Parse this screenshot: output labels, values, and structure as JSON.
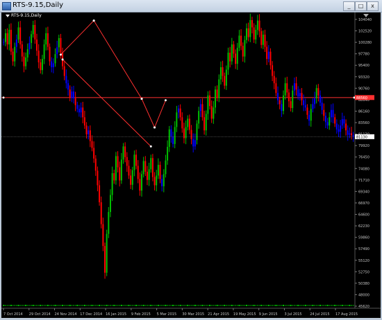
{
  "window": {
    "title": "RTS-9.15,Daily",
    "minimize_label": "_",
    "maximize_label": "□",
    "close_label": "x"
  },
  "chart_label": "RTS-9.15,Daily",
  "colors": {
    "background": "#000000",
    "bull": "#00c000",
    "bear": "#ff0000",
    "neutral": "#0000ff",
    "grid": "#2a2a2a",
    "axis_text": "#c8c8c8",
    "trend": "#ff3030"
  },
  "chart_data": {
    "type": "candlestick",
    "title": "RTS-9.15,Daily",
    "y_ticks": [
      "104040",
      "102520",
      "100280",
      "97780",
      "95400",
      "93320",
      "90760",
      "88640",
      "86160",
      "83560",
      "81130",
      "79920",
      "76450",
      "74080",
      "71710",
      "69340",
      "66970",
      "64600",
      "62230",
      "59860",
      "57490",
      "55120",
      "52750",
      "50380",
      "48000",
      "45620"
    ],
    "x_ticks": [
      "7 Oct 2014",
      "29 Oct 2014",
      "24 Nov 2014",
      "17 Dec 2014",
      "16 Jan 2015",
      "9 Feb 2015",
      "5 Mar 2015",
      "30 Mar 2015",
      "21 Apr 2015",
      "19 May 2015",
      "9 Jun 2015",
      "3 Jul 2015",
      "24 Jul 2015",
      "17 Aug 2015"
    ],
    "ylim": [
      45620,
      105500
    ],
    "current_price": "81130",
    "hline_price": "88560",
    "hline_value": 88560,
    "closes": [
      100000,
      101800,
      99500,
      102500,
      98000,
      96000,
      99000,
      100500,
      103000,
      99500,
      97000,
      95000,
      96800,
      98500,
      99800,
      101600,
      103500,
      100500,
      98200,
      95800,
      94200,
      96500,
      99500,
      101800,
      99000,
      96000,
      94800,
      95600,
      97500,
      98900,
      100800,
      97800,
      95000,
      93000,
      91500,
      90200,
      88500,
      89800,
      88400,
      87000,
      86200,
      85500,
      86500,
      84500,
      82800,
      81000,
      81800,
      79600,
      78200,
      76000,
      73500,
      70500,
      67000,
      62500,
      58000,
      52500,
      60500,
      65000,
      68500,
      73000,
      71500,
      76500,
      74200,
      71500,
      75800,
      78500,
      76300,
      74500,
      72500,
      70600,
      73600,
      76800,
      74500,
      71800,
      69400,
      72800,
      75500,
      73300,
      71600,
      73800,
      76100,
      72200,
      70500,
      72500,
      74700,
      71800,
      70300,
      72800,
      75600,
      78400,
      82000,
      80500,
      79000,
      82500,
      85500,
      86300,
      84500,
      82200,
      80200,
      82500,
      84200,
      81900,
      80000,
      78500,
      79800,
      83200,
      85800,
      87200,
      84500,
      81800,
      85200,
      89000,
      86800,
      84200,
      86500,
      90200,
      88500,
      92300,
      94800,
      93000,
      91000,
      94300,
      97800,
      96000,
      99500,
      97600,
      95500,
      98800,
      101300,
      99200,
      97000,
      100400,
      102800,
      101000,
      104500,
      103000,
      100500,
      102500,
      104400,
      102200,
      99400,
      101500,
      99000,
      96500,
      98000,
      95200,
      93000,
      91500,
      89500,
      88000,
      87200,
      85800,
      89000,
      91500,
      89600,
      87800,
      86400,
      90000,
      91500,
      90200,
      88800,
      89500,
      88000,
      87000,
      86500,
      85000,
      83800,
      86200,
      87200,
      88400,
      90500,
      89000,
      87500,
      86000,
      84800,
      83500,
      82800,
      84500,
      86000,
      84500,
      83200,
      82000,
      81500,
      82800,
      84100,
      83200,
      81800,
      80900,
      81200,
      80800,
      80500
    ],
    "trend_lines": [
      {
        "from": [
          31,
          97400
        ],
        "to": [
          49,
          104400
        ]
      },
      {
        "from": [
          49,
          104400
        ],
        "to": [
          75,
          88300
        ]
      },
      {
        "from": [
          32,
          96400
        ],
        "to": [
          80,
          78500
        ]
      },
      {
        "from": [
          75,
          88300
        ],
        "to": [
          82,
          82400
        ]
      },
      {
        "from": [
          82,
          82400
        ],
        "to": [
          88,
          88000
        ]
      }
    ],
    "grid": false
  }
}
